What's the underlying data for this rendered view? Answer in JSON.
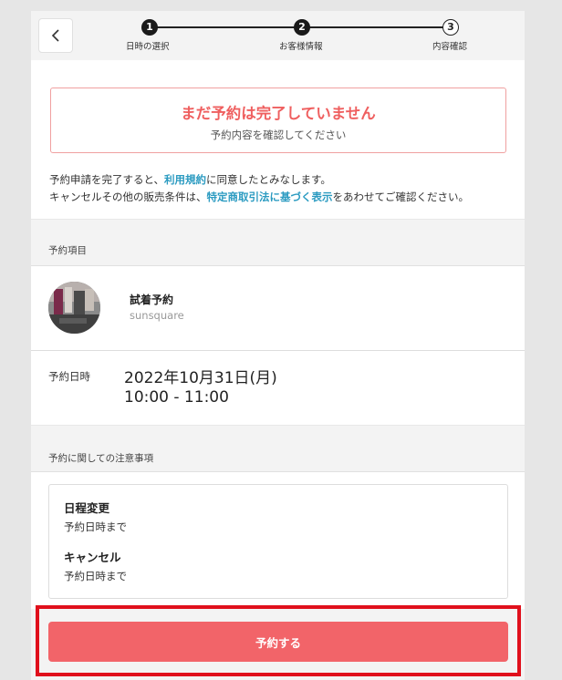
{
  "stepper": {
    "steps": [
      {
        "number": "1",
        "label": "日時の選択",
        "state": "done"
      },
      {
        "number": "2",
        "label": "お客様情報",
        "state": "done"
      },
      {
        "number": "3",
        "label": "内容確認",
        "state": "current"
      }
    ]
  },
  "notice": {
    "title": "まだ予約は完了していません",
    "subtitle": "予約内容を確認してください"
  },
  "terms": {
    "line1_before": "予約申請を完了すると、",
    "line1_link": "利用規約",
    "line1_after": "に同意したとみなします。",
    "line2_before": "キャンセルその他の販売条件は、",
    "line2_link": "特定商取引法に基づく表示",
    "line2_after": "をあわせてご確認ください。"
  },
  "reservation_item": {
    "section_title": "予約項目",
    "name": "試着予約",
    "shop": "sunsquare"
  },
  "datetime": {
    "label": "予約日時",
    "date": "2022年10月31日(月)",
    "time": "10:00 - 11:00"
  },
  "notes": {
    "section_title": "予約に関しての注意事項",
    "items": [
      {
        "heading": "日程変更",
        "value": "予約日時まで"
      },
      {
        "heading": "キャンセル",
        "value": "予約日時まで"
      }
    ]
  },
  "submit_label": "予約する",
  "colors": {
    "accent": "#f26469",
    "notice_text": "#ef5f5f",
    "link": "#2b9bc1",
    "highlight": "#e0101c"
  }
}
